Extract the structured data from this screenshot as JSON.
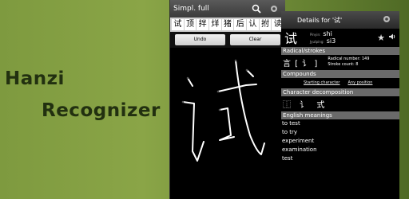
{
  "banner": {
    "line1": "Hanzi",
    "line2": "Recognizer"
  },
  "recognizer": {
    "mode_label": "Simpl. full",
    "candidates": [
      "试",
      "顶",
      "拌",
      "烊",
      "猪",
      "后",
      "认",
      "拊",
      "读"
    ],
    "undo_label": "Undo",
    "clear_label": "Clear"
  },
  "details": {
    "title": "Details for '试'",
    "character": "试",
    "pinyin_label": "Pinyin:",
    "pinyin_value": "shi",
    "jyutping_label": "Jyutping:",
    "jyutping_value": "si3",
    "radical_header": "Radical/strokes",
    "radical_chars": "言 [ 讠 ]",
    "radical_number_text": "Radical number: 149",
    "stroke_count_text": "Stroke count: 8",
    "compounds_header": "Compounds",
    "compound_links": [
      "Starting character",
      "Any position"
    ],
    "decomposition_header": "Character decomposition",
    "decomposition_chars": "⿰ 讠 式",
    "meanings_header": "English meanings",
    "meanings": [
      "to test",
      "to try",
      "experiment",
      "examination",
      "test"
    ]
  },
  "icons": {
    "search": "search-icon",
    "settings": "gear-icon",
    "star": "star-icon",
    "speaker": "speaker-icon"
  }
}
